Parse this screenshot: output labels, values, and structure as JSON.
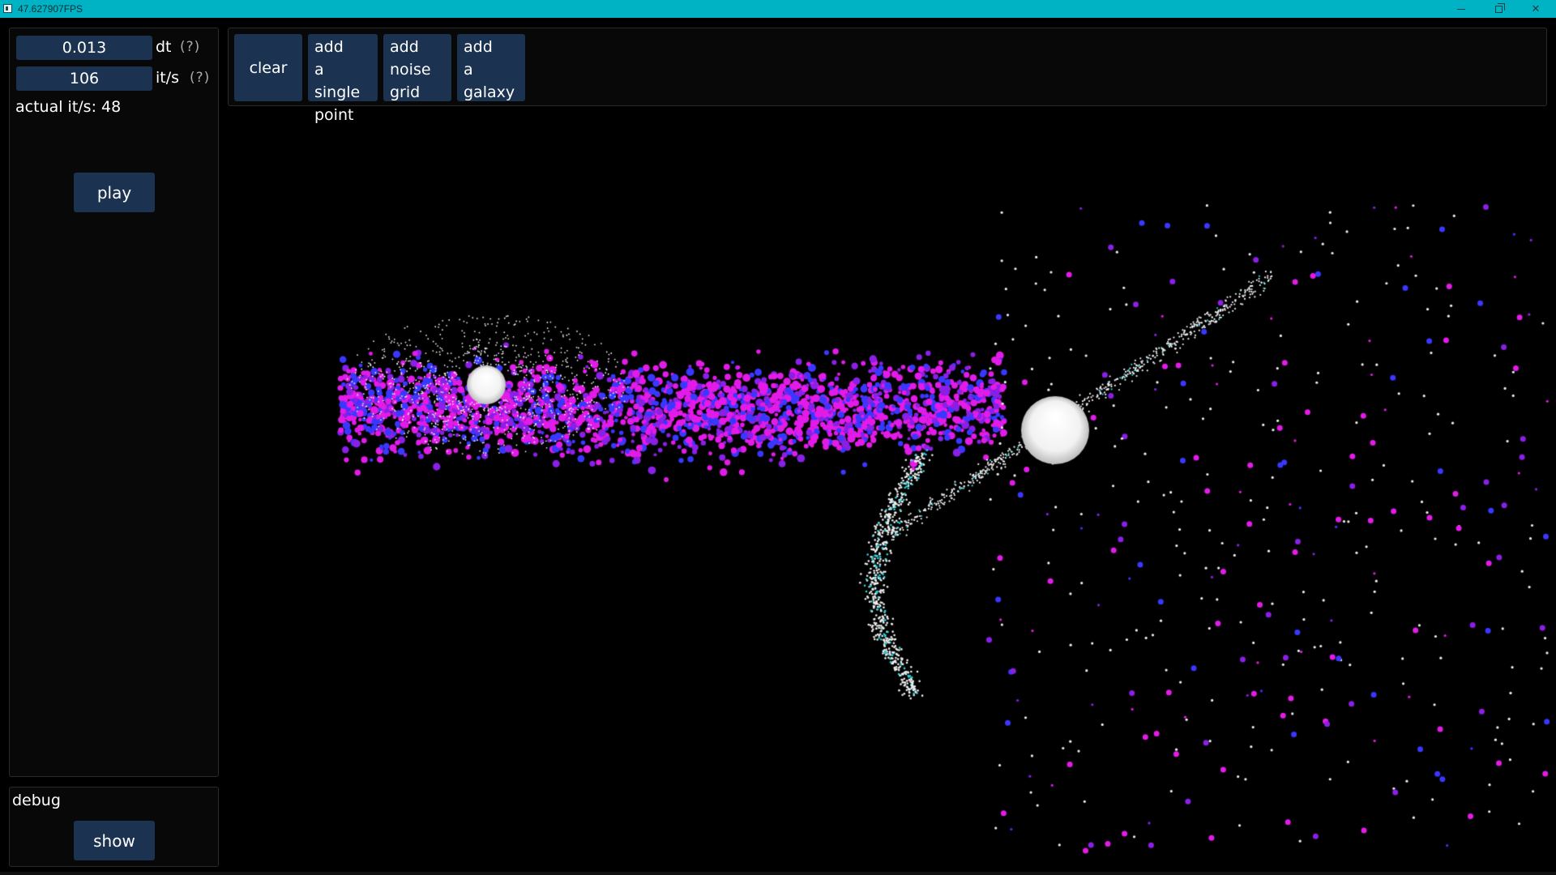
{
  "window": {
    "title": "47.627907FPS",
    "min_glyph": "",
    "max_glyph": "",
    "close_glyph": "✕"
  },
  "controls": {
    "dt_value": "0.013",
    "dt_label": "dt",
    "dt_help": "(?)",
    "its_value": "106",
    "its_label": "it/s",
    "its_help": "(?)",
    "actual_its": "actual it/s: 48",
    "play_label": "play"
  },
  "toolbar": {
    "clear_label": "clear",
    "add_point_lines": [
      "add",
      "a single",
      "point"
    ],
    "add_noise_lines": [
      "add",
      "noise",
      "grid"
    ],
    "add_galaxy_lines": [
      "add",
      "a",
      "galaxy"
    ]
  },
  "debug": {
    "title": "debug",
    "show_label": "show"
  },
  "colors": {
    "titlebar": "#00b3c4",
    "button": "#1b3350",
    "magenta_particle": "#e31be8",
    "violet_particle": "#8a1fe6",
    "blue_particle": "#3a37ff",
    "white_particle": "#f0f0f0",
    "cyan_particle": "#26d6e0"
  }
}
